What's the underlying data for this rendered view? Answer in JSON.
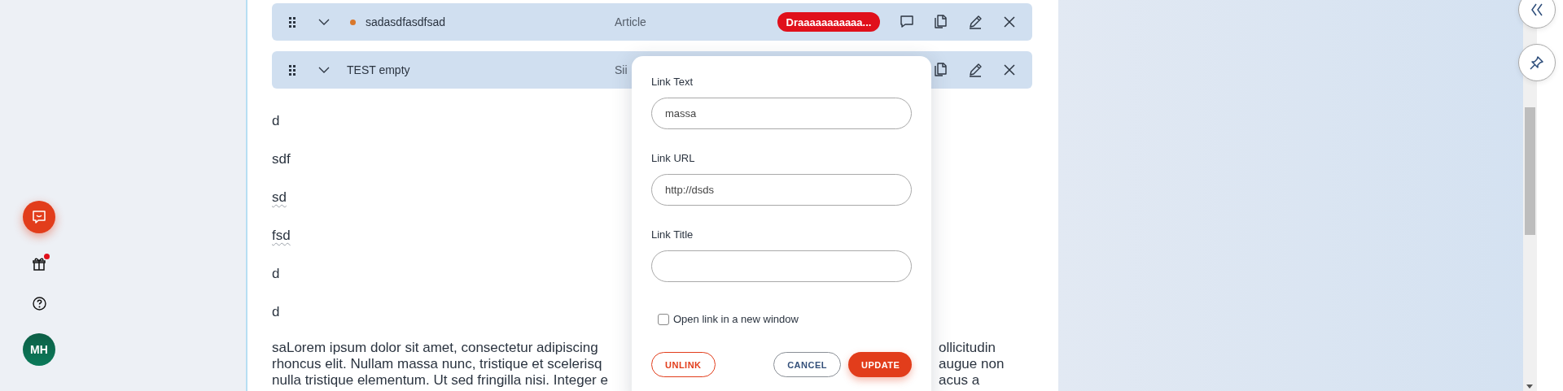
{
  "rail": {
    "gift_notification": true,
    "avatar": {
      "initials": "MH"
    }
  },
  "rows": [
    {
      "title": "sadasdfasdfsad",
      "color": "#d9782c",
      "type": "Article",
      "badge": "Draaaaaaaaaaa...",
      "actions": [
        {
          "kind": "comment"
        },
        {
          "kind": "copy"
        },
        {
          "kind": "edit"
        },
        {
          "kind": "close"
        }
      ]
    },
    {
      "title": "TEST empty",
      "type": "Sii",
      "actions": [
        {
          "kind": "copy"
        },
        {
          "kind": "edit"
        },
        {
          "kind": "close"
        }
      ]
    }
  ],
  "lines": [
    {
      "text": "d",
      "misspelled": false
    },
    {
      "text": "sdf",
      "misspelled": false
    },
    {
      "text": "sd",
      "misspelled": true
    },
    {
      "text": "fsd",
      "misspelled": true
    },
    {
      "text": "d",
      "misspelled": false
    },
    {
      "text": "d",
      "misspelled": false
    }
  ],
  "paragraph": {
    "left_lines": [
      "saLorem ipsum dolor sit amet, consectetur adipiscing",
      "rhoncus elit. Nullam massa nunc, tristique et scelerisq",
      "nulla tristique elementum. Ut sed fringilla nisi. Integer e"
    ],
    "right_lines": [
      "ollicitudin",
      "augue non",
      "acus a"
    ]
  },
  "dialog": {
    "fields": [
      {
        "label": "Link Text",
        "value": "massa"
      },
      {
        "label": "Link URL",
        "value": "http://dsds"
      },
      {
        "label": "Link Title"
      }
    ],
    "checkbox": {
      "label": "Open link in a new window",
      "checked": false
    },
    "buttons": [
      {
        "label": "UNLINK",
        "kind": "danger-outline"
      },
      {
        "label": "CANCEL",
        "kind": "outline"
      },
      {
        "label": "UPDATE",
        "kind": "primary"
      }
    ]
  }
}
